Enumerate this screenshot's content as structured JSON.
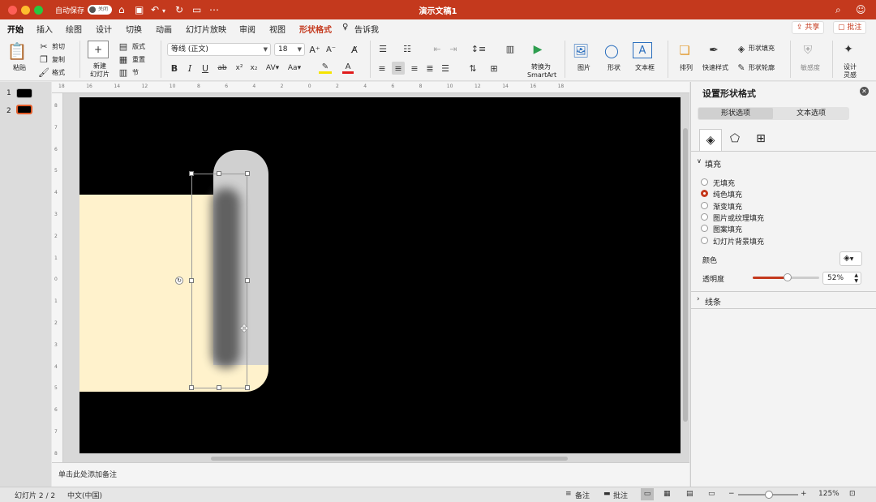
{
  "titlebar": {
    "autosave_label": "自动保存",
    "autosave_state": "关闭",
    "doc_title": "演示文稿1",
    "colors": {
      "bar": "#c4391d",
      "close": "#fe5f57",
      "min": "#febc2e",
      "max": "#28c840"
    }
  },
  "tabs": [
    "开始",
    "插入",
    "绘图",
    "设计",
    "切换",
    "动画",
    "幻灯片放映",
    "审阅",
    "视图",
    "形状格式",
    "告诉我"
  ],
  "tab_buttons": {
    "share": "共享",
    "comment": "批注"
  },
  "ribbon": {
    "paste": "粘贴",
    "cut": "剪切",
    "copy": "复制",
    "format": "格式",
    "new_slide": "新建",
    "new_slide2": "幻灯片",
    "layout": "版式",
    "reset": "重置",
    "section": "节",
    "font_name": "等线 (正文)",
    "font_size": "18",
    "convert_smartart_1": "转换为",
    "convert_smartart_2": "SmartArt",
    "picture": "图片",
    "shape": "形状",
    "textbox": "文本框",
    "arrange": "排列",
    "quick_style": "快速样式",
    "shape_fill": "形状填充",
    "shape_outline": "形状轮廓",
    "sensitivity": "敏感度",
    "design_1": "设计",
    "design_2": "灵感"
  },
  "slides": {
    "numbers": [
      "1",
      "2"
    ]
  },
  "notes_placeholder": "单击此处添加备注",
  "panel": {
    "title": "设置形状格式",
    "tabs": [
      "形状选项",
      "文本选项"
    ],
    "section_fill": "填充",
    "fill_options": [
      "无填充",
      "纯色填充",
      "渐变填充",
      "图片或纹理填充",
      "图案填充",
      "幻灯片背景填充"
    ],
    "selected_fill": "纯色填充",
    "color_label": "颜色",
    "transparency_label": "透明度",
    "transparency_value": "52%",
    "transparency_level": 0.52,
    "section_line": "线条"
  },
  "status": {
    "slide": "幻灯片 2 / 2",
    "lang": "中文(中国)",
    "notes": "备注",
    "comments": "批注",
    "zoom": "125%"
  },
  "ruler_top": [
    "18",
    "16",
    "14",
    "12",
    "10",
    "8",
    "6",
    "4",
    "2",
    "0",
    "2",
    "4",
    "6",
    "8",
    "10",
    "12",
    "14",
    "16",
    "18"
  ],
  "ruler_left": [
    "8",
    "7",
    "6",
    "5",
    "4",
    "3",
    "2",
    "1",
    "0",
    "1",
    "2",
    "3",
    "4",
    "5",
    "6",
    "7",
    "8"
  ]
}
